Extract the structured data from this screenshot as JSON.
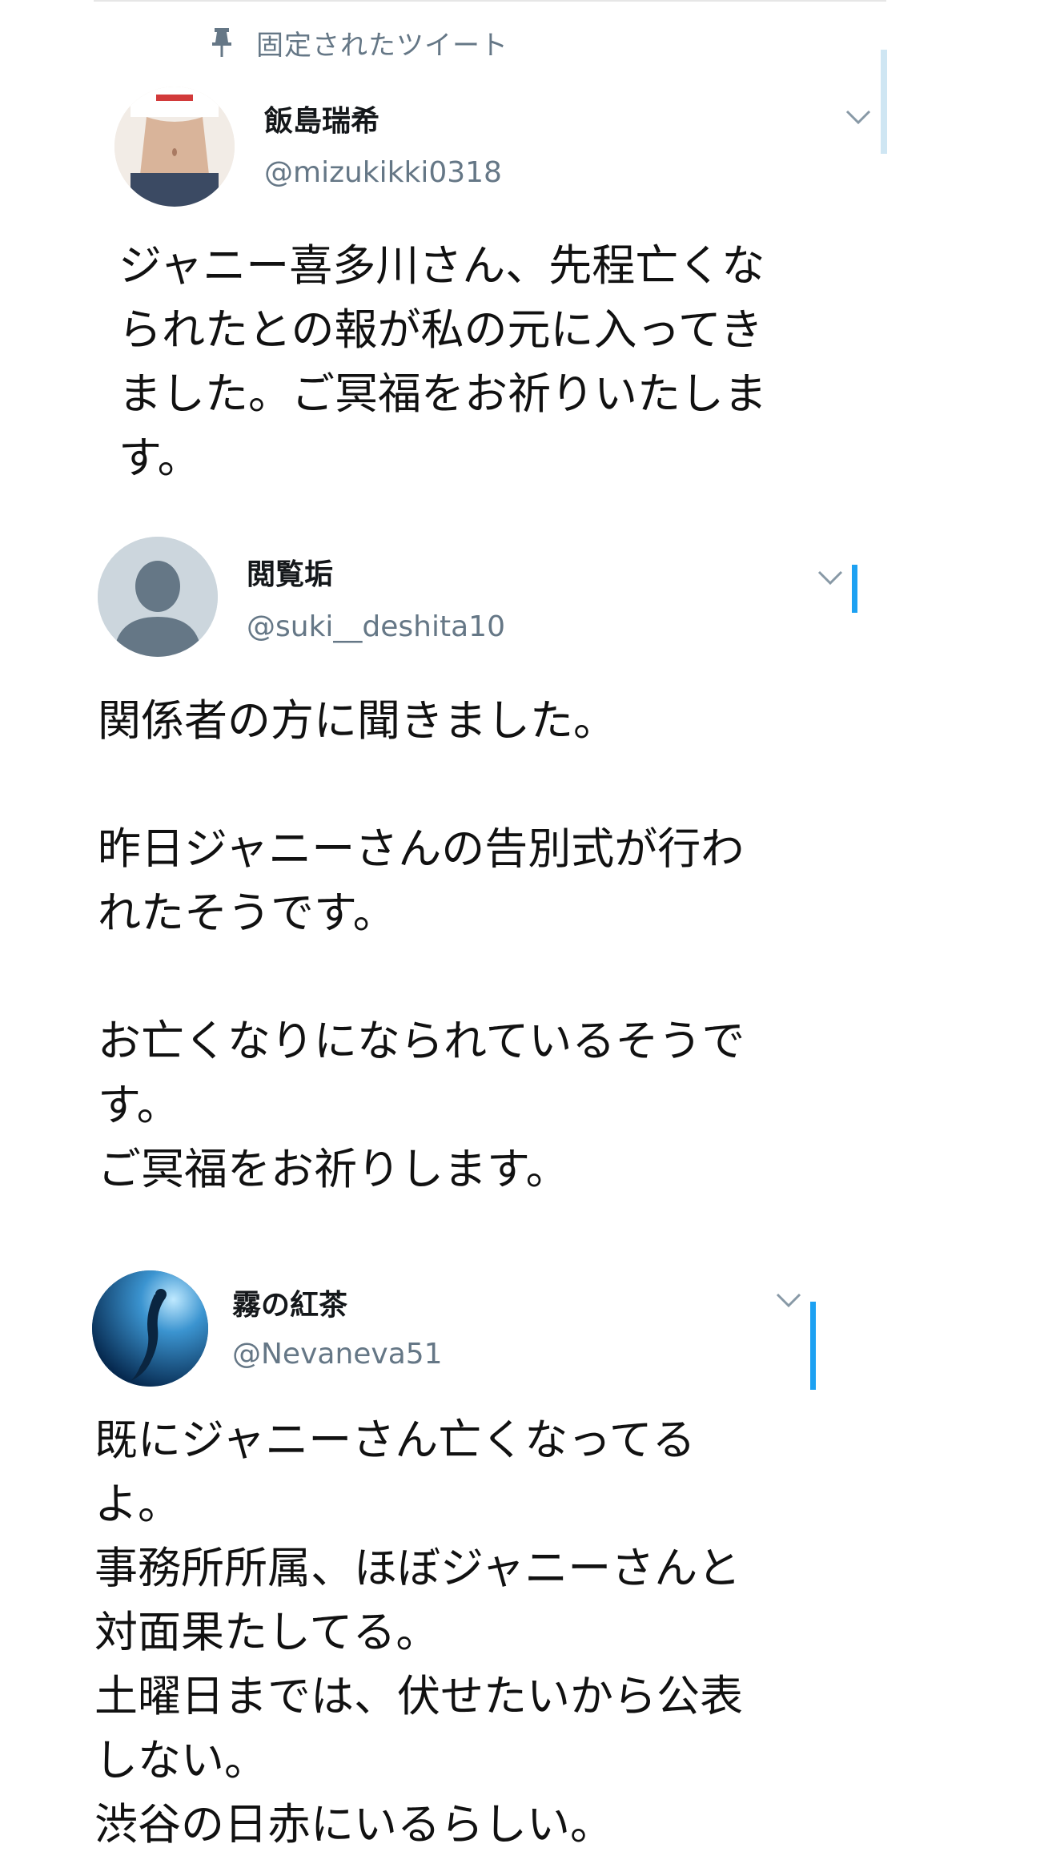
{
  "pinned": {
    "label": "固定されたツイート",
    "icon": "pin-icon"
  },
  "tweets": [
    {
      "name": "飯島瑞希",
      "handle": "@mizukikki0318",
      "text": "ジャニー喜多川さん、先程亡くな\nられたとの報が私の元に入ってき\nました。ご冥福をお祈りいたしま\nす。"
    },
    {
      "name": "閲覧垢",
      "handle": "@suki__deshita10",
      "text": "関係者の方に聞きました。\n\n昨日ジャニーさんの告別式が行わ\nれたそうです。\n\nお亡くなりになられているそうで\nす。\nご冥福をお祈りします。"
    },
    {
      "name": "霧の紅茶",
      "handle": "@Nevaneva51",
      "text": "既にジャニーさん亡くなってる\nよ。\n事務所所属、ほぼジャニーさんと\n対面果たしてる。\n土曜日までは、伏せたいから公表\nしない。\n渋谷の日赤にいるらしい。"
    }
  ],
  "colors": {
    "accent": "#1da1f2",
    "secondary": "#657786",
    "text": "#111111"
  }
}
